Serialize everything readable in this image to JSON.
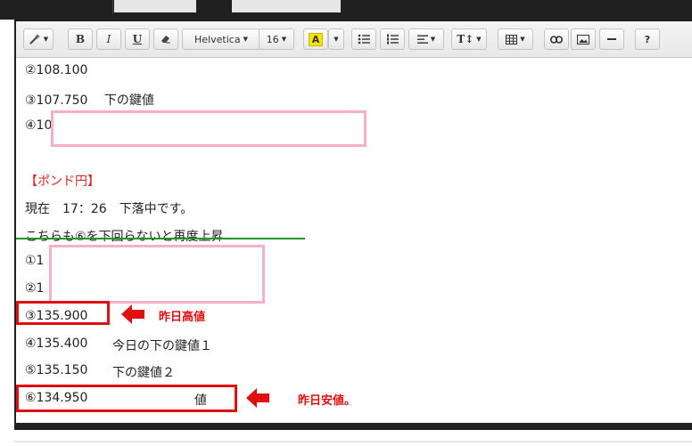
{
  "toolbar": {
    "font_name": "Helvetica",
    "font_size": "16",
    "color_letter": "A",
    "help": "?"
  },
  "content": {
    "lines": [
      "②108.100",
      "③107.750　 下の鍵値",
      "④10",
      "【ポンド円】",
      "現在　17：26　下落中です。",
      "こちらも⑥を下回らないと再度上昇",
      "①1",
      "②1",
      "③135.900",
      "④135.400",
      "今日の下の鍵値１",
      "⑤135.150",
      "下の鍵値２",
      "⑥134.950",
      "値"
    ]
  },
  "annotations": {
    "high": "昨日高値",
    "low": "昨日安値。"
  },
  "colors": {
    "accent_red": "#e01010",
    "pink_redaction": "#f4b0c8",
    "green_line": "#1a9a2a"
  }
}
